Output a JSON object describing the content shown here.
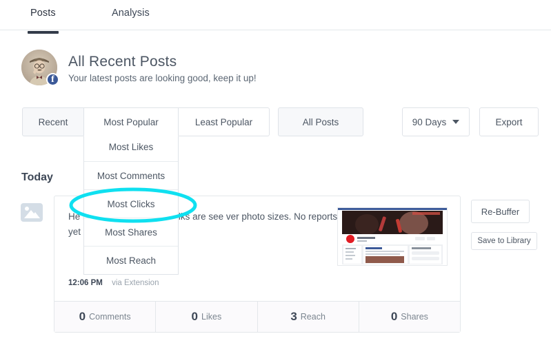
{
  "tabs": [
    {
      "label": "Posts",
      "active": true
    },
    {
      "label": "Analysis",
      "active": false
    }
  ],
  "header": {
    "title": "All Recent Posts",
    "subtitle": "Your latest posts are looking good, keep it up!",
    "avatar_name": "profile-avatar",
    "network_badge": "f"
  },
  "filters": {
    "recent": "Recent",
    "most_popular": "Most Popular",
    "least_popular": "Least Popular",
    "all_posts": "All Posts",
    "date_range": "90 Days",
    "export": "Export"
  },
  "dropdown": {
    "items": [
      {
        "label": "Most Likes"
      },
      {
        "label": "Most Comments"
      },
      {
        "label": "Most Clicks"
      },
      {
        "label": "Most Shares"
      },
      {
        "label": "Most Reach"
      }
    ]
  },
  "section": {
    "today_label": "Today"
  },
  "post": {
    "text": "He                             ng reports that some folks are see                     ver photo sizes.  No reports yet of any                 this option.",
    "time": "12:06 PM",
    "via": "via Extension",
    "stats": [
      {
        "value": "0",
        "label": "Comments"
      },
      {
        "value": "0",
        "label": "Likes"
      },
      {
        "value": "3",
        "label": "Reach"
      },
      {
        "value": "0",
        "label": "Shares"
      }
    ],
    "actions": {
      "rebuffer": "Re-Buffer",
      "save_to_library": "Save to Library"
    }
  },
  "annotation": {
    "shape": "ellipse",
    "color": "#0fe0f0",
    "targets": "Most Clicks"
  },
  "colors": {
    "accent_underline": "#333b49",
    "border": "#dfe3e8",
    "text": "#4c5663",
    "muted": "#9aa3ad",
    "shaded_button": "#f7f8fa",
    "facebook": "#3b5998",
    "annotation": "#0fe0f0"
  }
}
